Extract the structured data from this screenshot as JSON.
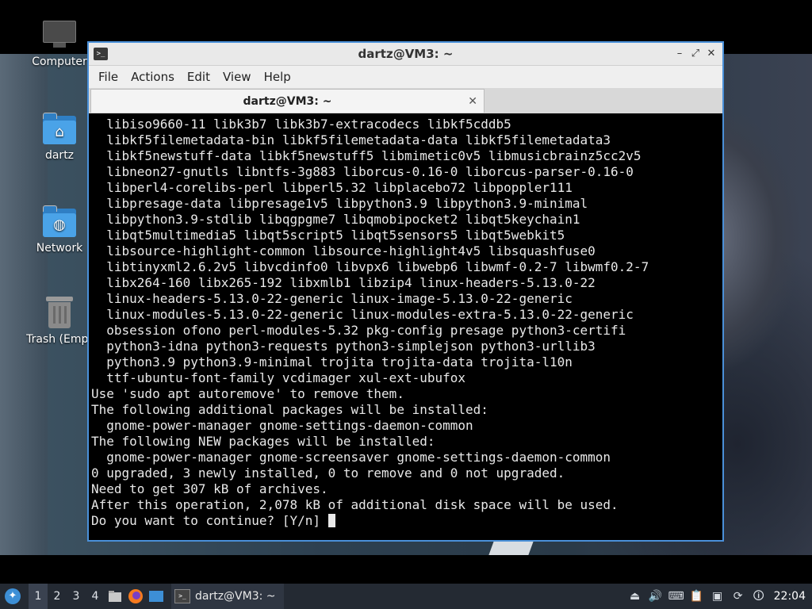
{
  "desktop": {
    "icons": [
      {
        "label": "Computer",
        "icon": "computer-icon"
      },
      {
        "label": "dartz",
        "icon": "home-folder-icon"
      },
      {
        "label": "Network",
        "icon": "network-folder-icon"
      },
      {
        "label": "Trash (Empt",
        "icon": "trash-icon"
      }
    ]
  },
  "window": {
    "title": "dartz@VM3: ~",
    "controls": {
      "minimize": "–",
      "maximize": "⤢",
      "close": "✕"
    },
    "menu": [
      "File",
      "Actions",
      "Edit",
      "View",
      "Help"
    ],
    "tab": {
      "label": "dartz@VM3: ~",
      "close": "✕"
    }
  },
  "terminal": {
    "lines": [
      "  libiso9660-11 libk3b7 libk3b7-extracodecs libkf5cddb5",
      "  libkf5filemetadata-bin libkf5filemetadata-data libkf5filemetadata3",
      "  libkf5newstuff-data libkf5newstuff5 libmimetic0v5 libmusicbrainz5cc2v5",
      "  libneon27-gnutls libntfs-3g883 liborcus-0.16-0 liborcus-parser-0.16-0",
      "  libperl4-corelibs-perl libperl5.32 libplacebo72 libpoppler111",
      "  libpresage-data libpresage1v5 libpython3.9 libpython3.9-minimal",
      "  libpython3.9-stdlib libqgpgme7 libqmobipocket2 libqt5keychain1",
      "  libqt5multimedia5 libqt5script5 libqt5sensors5 libqt5webkit5",
      "  libsource-highlight-common libsource-highlight4v5 libsquashfuse0",
      "  libtinyxml2.6.2v5 libvcdinfo0 libvpx6 libwebp6 libwmf-0.2-7 libwmf0.2-7",
      "  libx264-160 libx265-192 libxmlb1 libzip4 linux-headers-5.13.0-22",
      "  linux-headers-5.13.0-22-generic linux-image-5.13.0-22-generic",
      "  linux-modules-5.13.0-22-generic linux-modules-extra-5.13.0-22-generic",
      "  obsession ofono perl-modules-5.32 pkg-config presage python3-certifi",
      "  python3-idna python3-requests python3-simplejson python3-urllib3",
      "  python3.9 python3.9-minimal trojita trojita-data trojita-l10n",
      "  ttf-ubuntu-font-family vcdimager xul-ext-ubufox",
      "Use 'sudo apt autoremove' to remove them.",
      "The following additional packages will be installed:",
      "  gnome-power-manager gnome-settings-daemon-common",
      "The following NEW packages will be installed:",
      "  gnome-power-manager gnome-screensaver gnome-settings-daemon-common",
      "0 upgraded, 3 newly installed, 0 to remove and 0 not upgraded.",
      "Need to get 307 kB of archives.",
      "After this operation, 2,078 kB of additional disk space will be used."
    ],
    "prompt": "Do you want to continue? [Y/n] "
  },
  "taskbar": {
    "workspaces": [
      "1",
      "2",
      "3",
      "4"
    ],
    "active_workspace": "1",
    "task_label": "dartz@VM3: ~",
    "clock": "22:04"
  },
  "colors": {
    "accent": "#4a90d9",
    "taskbar": "#242a33",
    "terminal_bg": "#000000",
    "terminal_fg": "#e8e8e8"
  }
}
